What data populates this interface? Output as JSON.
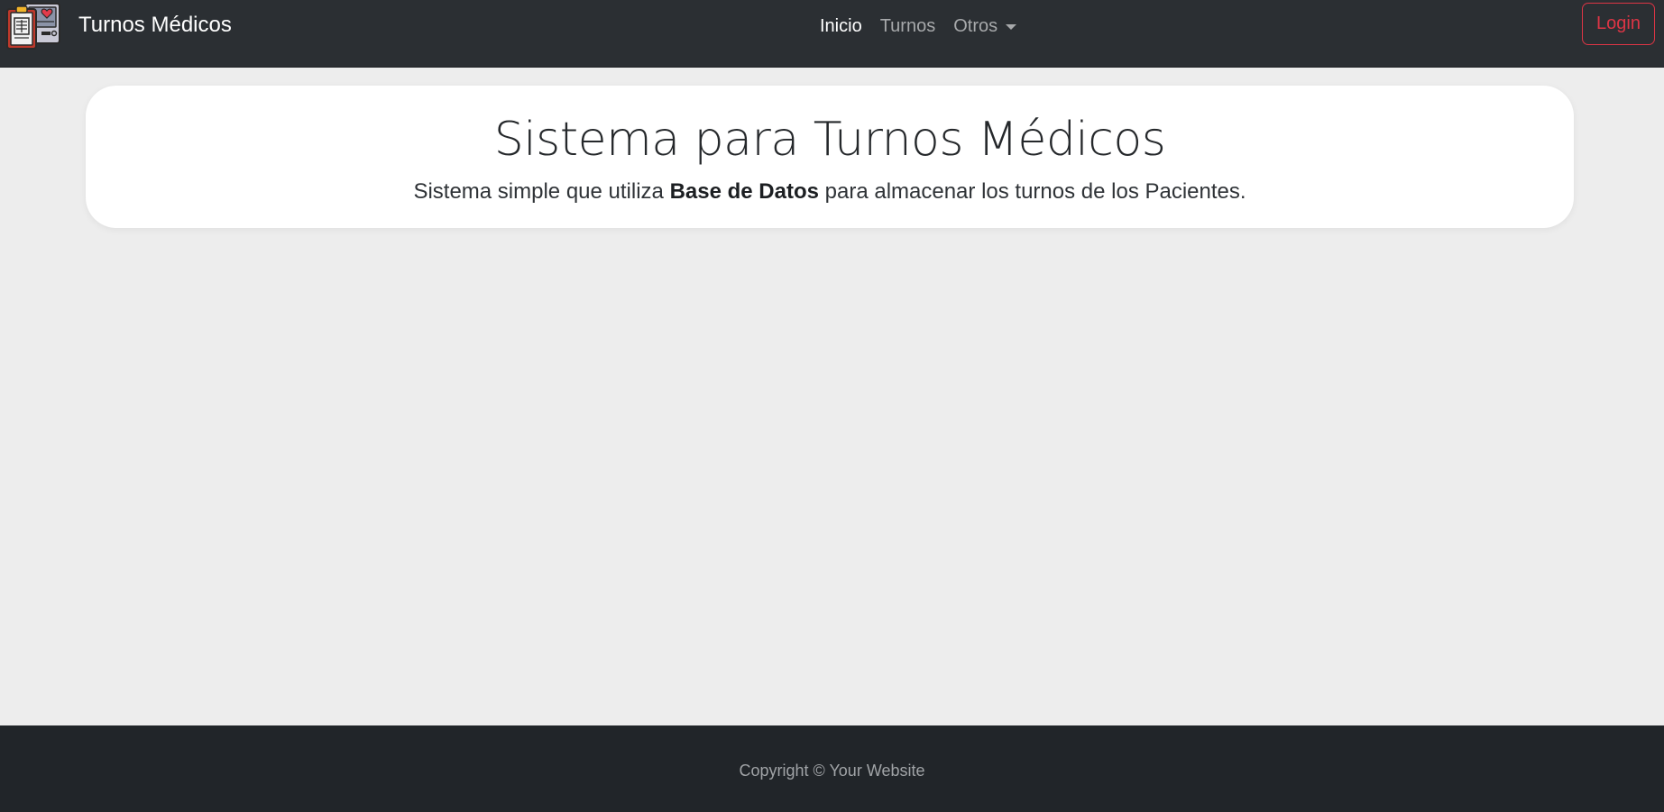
{
  "navbar": {
    "brand": "Turnos Médicos",
    "logo_icon": "medical-clipboard-heart-icon",
    "links": [
      {
        "label": "Inicio",
        "active": true
      },
      {
        "label": "Turnos",
        "active": false
      },
      {
        "label": "Otros",
        "active": false,
        "has_dropdown": true
      }
    ],
    "login_label": "Login"
  },
  "hero": {
    "title": "Sistema para Turnos Médicos",
    "subtitle_before": "Sistema simple que utiliza ",
    "subtitle_bold": "Base de Datos",
    "subtitle_after": " para almacenar los turnos de los Pacientes."
  },
  "footer": {
    "copyright": "Copyright © Your Website"
  },
  "colors": {
    "navbar_bg": "#2b2f33",
    "page_bg": "#ededed",
    "footer_bg": "#212529",
    "login_accent": "#dc3545"
  }
}
